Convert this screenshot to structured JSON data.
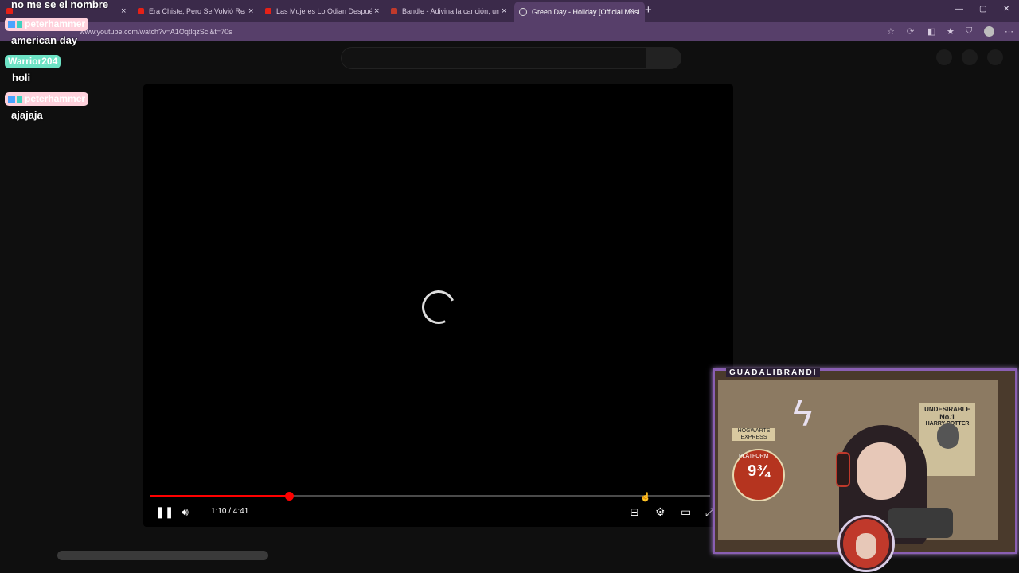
{
  "browser": {
    "tabs": [
      {
        "label": "",
        "favicon_color": "#e62117"
      },
      {
        "label": "Era Chiste, Pero Se Volvió Real - Y",
        "favicon_color": "#e62117"
      },
      {
        "label": "Las Mujeres Lo Odian Después De",
        "favicon_color": "#e62117"
      },
      {
        "label": "Bandle - Adivina la canción, un ins",
        "favicon_color": "#c0392b"
      },
      {
        "label": "Green Day - Holiday [Official Musi",
        "favicon_color": "#e62117"
      }
    ],
    "close_glyph": "×",
    "newtab_glyph": "+",
    "url": "www.youtube.com/watch?v=A1OqtlqzScl&t=70s",
    "window_controls": [
      "—",
      "▢",
      "✕"
    ]
  },
  "chat": [
    {
      "user": "",
      "message": "no me se el nombre"
    },
    {
      "user": "peterhammer",
      "message": "american day",
      "color": "#ffd1dc",
      "text_color": "#ffffff"
    },
    {
      "user": "Warrior204",
      "message": "holi",
      "color": "#6de3c5",
      "text_color": "#ffffff"
    },
    {
      "user": "peterhammer",
      "message": "ajajaja",
      "color": "#ffd1dc",
      "text_color": "#ffffff"
    }
  ],
  "player": {
    "time_display": "1:10 / 4:41",
    "progress": 0.249,
    "accent": "#ff0000"
  },
  "webcam": {
    "streamer": "GUADALIBRANDI",
    "sign_left": "HOGWARTS EXPRESS",
    "platform_label": "PLATFORM",
    "platform_number": "9¾",
    "poster_title": "UNDESIRABLE",
    "poster_number": "No.1",
    "poster_name": "HARRY POTTER",
    "frame_color": "#8a5fb3"
  }
}
